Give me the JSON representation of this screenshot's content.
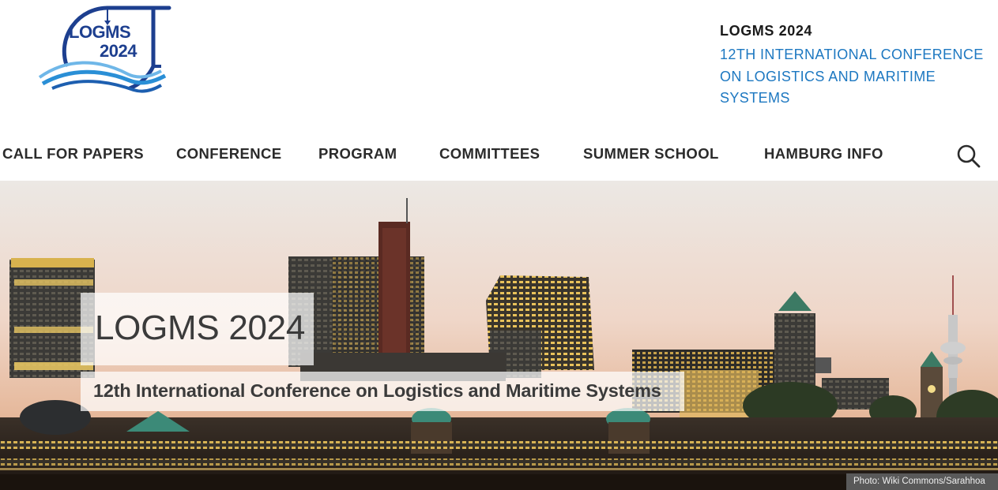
{
  "logo": {
    "line1": "LOGMS",
    "line2": "2024"
  },
  "header": {
    "conf_name": "LOGMS 2024",
    "conf_subtitle": "12TH INTERNATIONAL CONFERENCE ON LOGISTICS AND MARITIME SYSTEMS"
  },
  "nav": {
    "items": [
      {
        "label": "CALL FOR PAPERS"
      },
      {
        "label": "CONFERENCE"
      },
      {
        "label": "PROGRAM"
      },
      {
        "label": "COMMITTEES"
      },
      {
        "label": "SUMMER SCHOOL"
      },
      {
        "label": "HAMBURG INFO"
      }
    ]
  },
  "hero": {
    "title": "LOGMS 2024",
    "subtitle": "12th International Conference on Logistics and Maritime Systems",
    "photo_credit": "Photo: Wiki Commons/Sarahhoa"
  },
  "colors": {
    "accent_blue": "#1d78c1",
    "logo_navy": "#1d3f8f",
    "text_dark": "#2b2b2b"
  },
  "icons": {
    "search": "search-icon",
    "logo": "crane-wave-logo"
  }
}
